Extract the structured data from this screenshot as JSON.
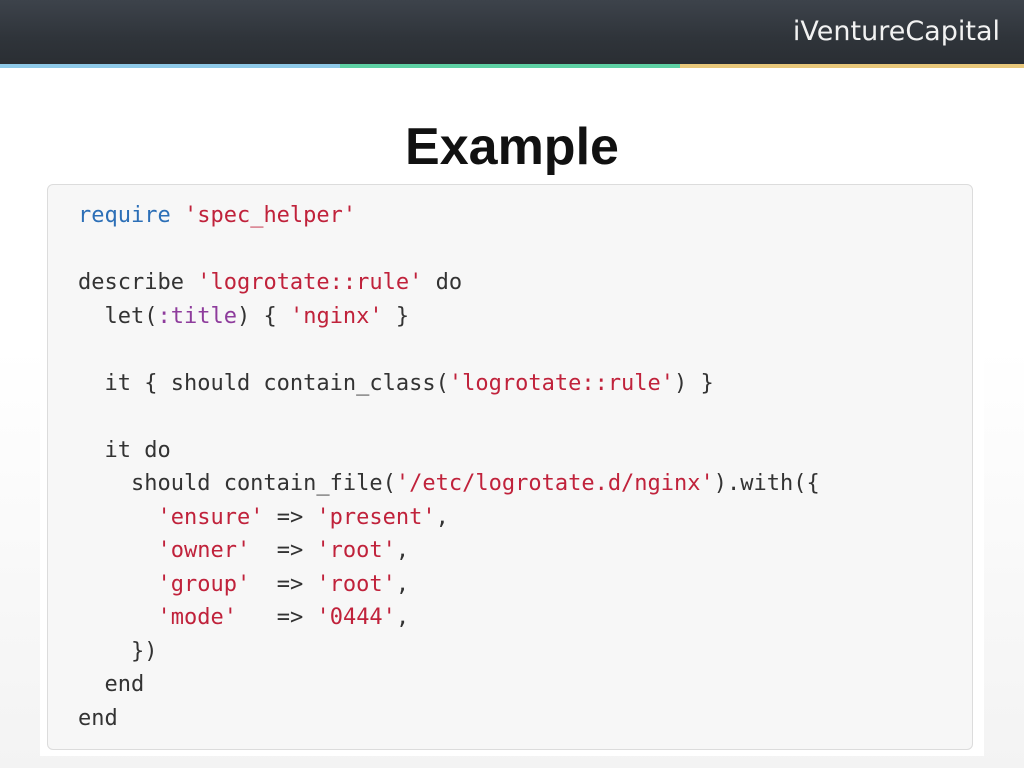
{
  "header": {
    "brand": "iVentureCapital",
    "accent_colors": [
      "#8ec9e8",
      "#5ed1a4",
      "#e8c77a"
    ]
  },
  "slide": {
    "title": "Example"
  },
  "code": {
    "colors": {
      "keyword": "#333333",
      "require": "#2c6fb7",
      "string": "#c0223b",
      "symbol": "#8e3c9c"
    },
    "lines": [
      [
        {
          "t": "require",
          "k": "req"
        },
        {
          "t": " ",
          "k": "plain"
        },
        {
          "t": "'spec_helper'",
          "k": "str"
        }
      ],
      [],
      [
        {
          "t": "describe ",
          "k": "plain"
        },
        {
          "t": "'logrotate::rule'",
          "k": "str"
        },
        {
          "t": " do",
          "k": "plain"
        }
      ],
      [
        {
          "t": "  let(",
          "k": "plain"
        },
        {
          "t": ":title",
          "k": "sym"
        },
        {
          "t": ") { ",
          "k": "plain"
        },
        {
          "t": "'nginx'",
          "k": "str"
        },
        {
          "t": " }",
          "k": "plain"
        }
      ],
      [],
      [
        {
          "t": "  it { should contain_class(",
          "k": "plain"
        },
        {
          "t": "'logrotate::rule'",
          "k": "str"
        },
        {
          "t": ") }",
          "k": "plain"
        }
      ],
      [],
      [
        {
          "t": "  it do",
          "k": "plain"
        }
      ],
      [
        {
          "t": "    should contain_file(",
          "k": "plain"
        },
        {
          "t": "'/etc/logrotate.d/nginx'",
          "k": "str"
        },
        {
          "t": ").with({",
          "k": "plain"
        }
      ],
      [
        {
          "t": "      ",
          "k": "plain"
        },
        {
          "t": "'ensure'",
          "k": "str"
        },
        {
          "t": " => ",
          "k": "plain"
        },
        {
          "t": "'present'",
          "k": "str"
        },
        {
          "t": ",",
          "k": "plain"
        }
      ],
      [
        {
          "t": "      ",
          "k": "plain"
        },
        {
          "t": "'owner'",
          "k": "str"
        },
        {
          "t": "  => ",
          "k": "plain"
        },
        {
          "t": "'root'",
          "k": "str"
        },
        {
          "t": ",",
          "k": "plain"
        }
      ],
      [
        {
          "t": "      ",
          "k": "plain"
        },
        {
          "t": "'group'",
          "k": "str"
        },
        {
          "t": "  => ",
          "k": "plain"
        },
        {
          "t": "'root'",
          "k": "str"
        },
        {
          "t": ",",
          "k": "plain"
        }
      ],
      [
        {
          "t": "      ",
          "k": "plain"
        },
        {
          "t": "'mode'",
          "k": "str"
        },
        {
          "t": "   => ",
          "k": "plain"
        },
        {
          "t": "'0444'",
          "k": "str"
        },
        {
          "t": ",",
          "k": "plain"
        }
      ],
      [
        {
          "t": "    })",
          "k": "plain"
        }
      ],
      [
        {
          "t": "  end",
          "k": "plain"
        }
      ],
      [
        {
          "t": "end",
          "k": "plain"
        }
      ]
    ]
  }
}
